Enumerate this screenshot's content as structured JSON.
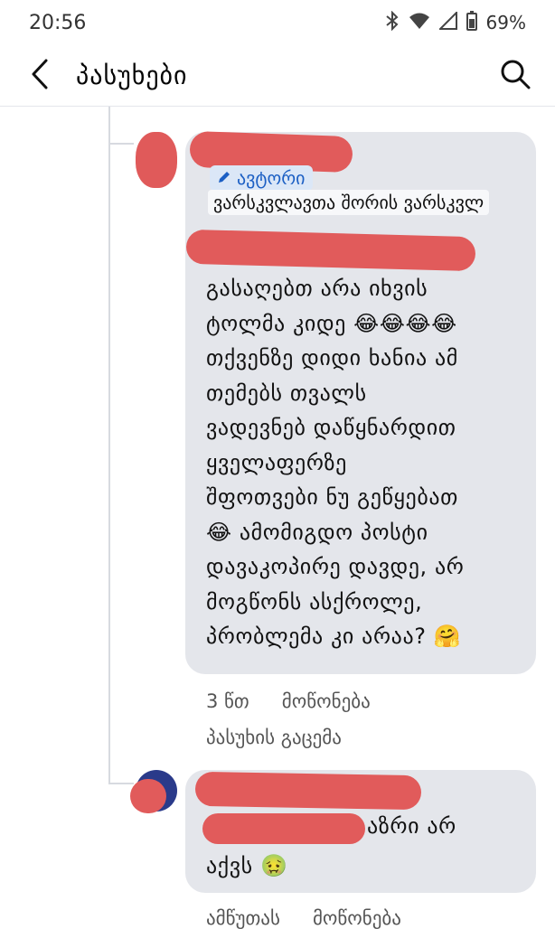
{
  "status": {
    "time": "20:56",
    "battery": "69%"
  },
  "header": {
    "title": "პასუხები"
  },
  "comment": {
    "author_badge": "ავტორი",
    "role": "ვარსკვლავთა შორის ვარსკვლ",
    "lines": [
      "გასაღებთ არა იხვის",
      "ტოლმა კიდე 😂😂😂😂",
      "თქვენზე დიდი ხანია ამ",
      "თემებს თვალს",
      "ვადევნებ დაწყნარდით",
      "ყველაფერზე",
      "შფოთვები ნუ გეწყებათ",
      "😂 ამომიგდო პოსტი",
      "დავაკოპირე დავდე, არ",
      "მოგწონს ასქროლე,",
      "პრობლემა კი არაა? 🤗"
    ],
    "time": "3 წთ",
    "like_label": "მოწონება",
    "reply_label": "პასუხის გაცემა"
  },
  "reply": {
    "text_part1": "აზრი არ",
    "text_part2": "აქვს 🤢",
    "more_label": "ამწუთას",
    "like_label": "მოწონება"
  }
}
